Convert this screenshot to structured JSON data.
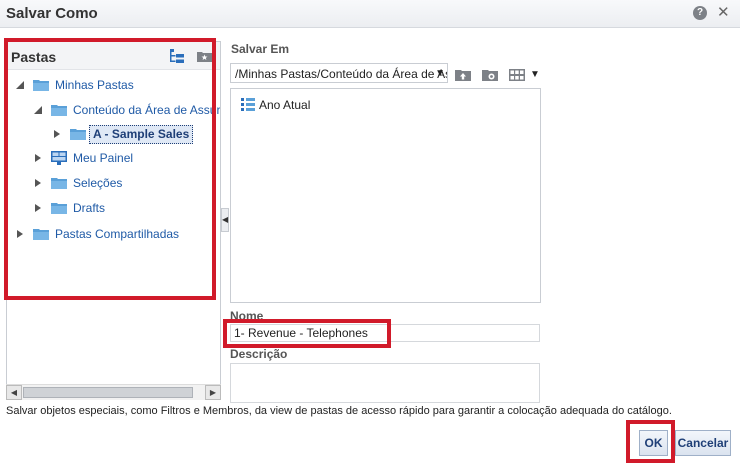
{
  "dialog": {
    "title": "Salvar Como",
    "help_icon": "help-icon",
    "close_icon": "close-icon"
  },
  "folders_panel": {
    "header": "Pastas",
    "header_icons": [
      "tree-view-icon",
      "new-folder-icon"
    ],
    "tree": [
      {
        "label": "Minhas Pastas",
        "expanded": true,
        "icon": "folder-icon"
      },
      {
        "label": "Conteúdo da Área de Assur",
        "expanded": true,
        "icon": "folder-icon"
      },
      {
        "label": "A - Sample Sales",
        "expanded": false,
        "selected": true,
        "icon": "folder-icon"
      },
      {
        "label": "Meu Painel",
        "expanded": false,
        "icon": "dashboard-icon"
      },
      {
        "label": "Seleções",
        "expanded": false,
        "icon": "folder-icon"
      },
      {
        "label": "Drafts",
        "expanded": false,
        "icon": "folder-icon"
      },
      {
        "label": "Pastas Compartilhadas",
        "expanded": false,
        "icon": "folder-icon"
      }
    ]
  },
  "save_in": {
    "label": "Salvar Em",
    "path": "/Minhas Pastas/Conteúdo da Área de Assur",
    "toolbar_icons": [
      "folder-up-icon",
      "new-folder-icon",
      "view-options-icon"
    ],
    "items": [
      {
        "label": "Ano Atual",
        "icon": "analysis-icon"
      }
    ]
  },
  "name_field": {
    "label": "Nome",
    "value": "1- Revenue - Telephones"
  },
  "description_field": {
    "label": "Descrição",
    "value": ""
  },
  "note": "Salvar objetos especiais, como Filtros e Membros, da view de pastas de acesso rápido para garantir a colocação adequada do catálogo.",
  "buttons": {
    "ok": "OK",
    "cancel": "Cancelar"
  },
  "colors": {
    "highlight": "#d11a2a",
    "link_blue": "#1f5aa6",
    "folder_blue": "#5aa0d8",
    "selected_bg": "#dfe8f5"
  }
}
